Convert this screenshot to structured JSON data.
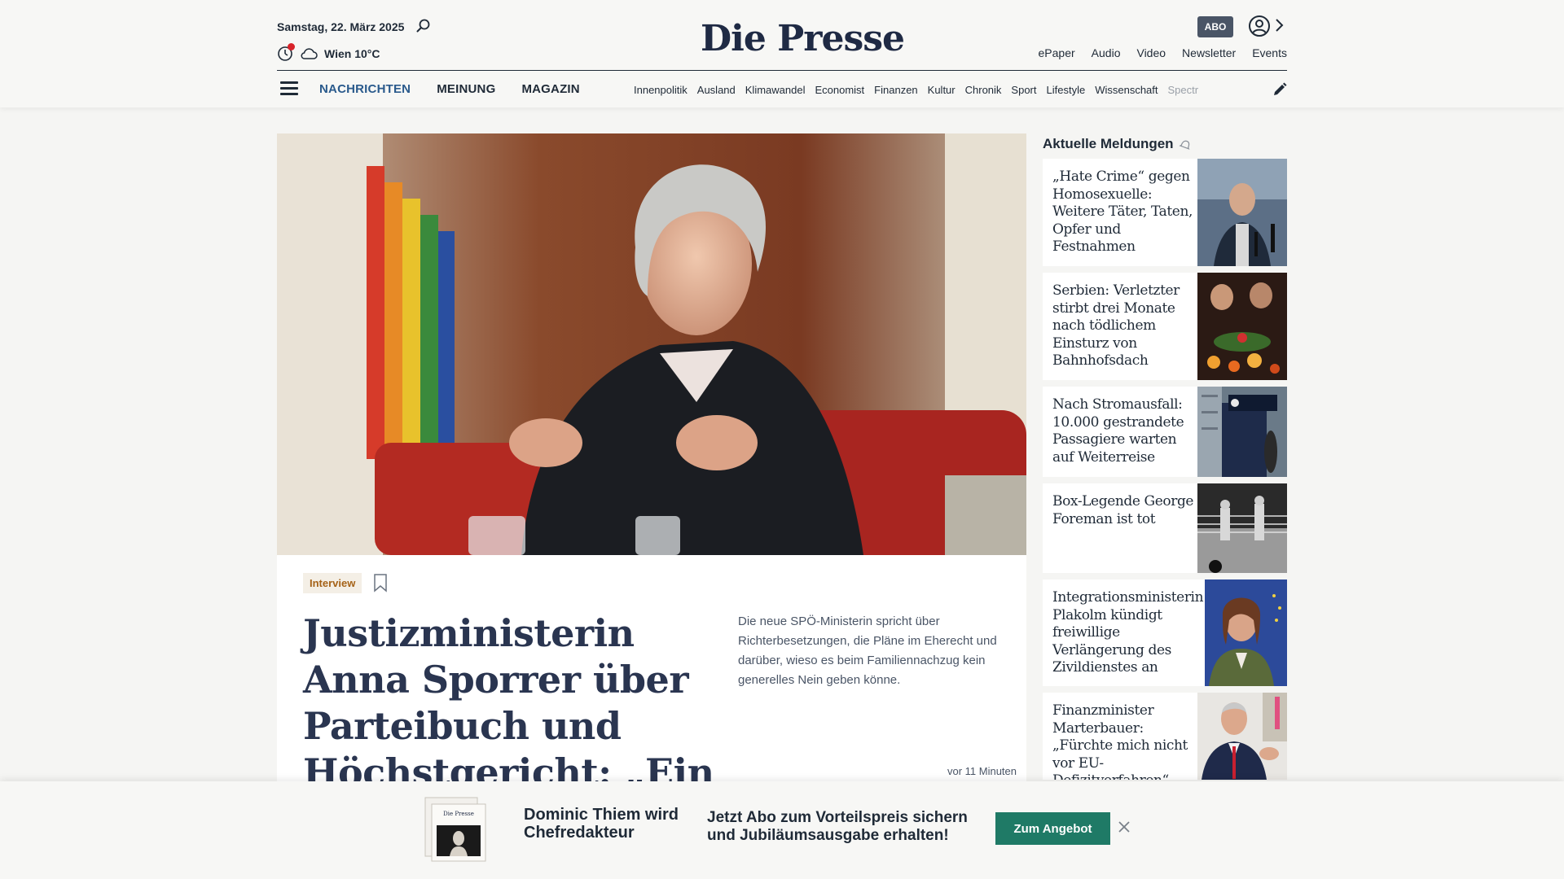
{
  "header": {
    "date": "Samstag, 22. März 2025",
    "weather": "Wien 10°C",
    "logo": "Die Presse",
    "abo_badge": "ABO",
    "top_links": [
      "ePaper",
      "Audio",
      "Video",
      "Newsletter",
      "Events"
    ],
    "main_nav": [
      {
        "label": "NACHRICHTEN",
        "active": true
      },
      {
        "label": "MEINUNG",
        "active": false
      },
      {
        "label": "MAGAZIN",
        "active": false
      }
    ],
    "sub_nav": [
      "Innenpolitik",
      "Ausland",
      "Klimawandel",
      "Economist",
      "Finanzen",
      "Kultur",
      "Chronik",
      "Sport",
      "Lifestyle",
      "Wissenschaft"
    ],
    "sub_nav_truncated": "Spectr"
  },
  "article": {
    "tag": "Interview",
    "headline": "Justizministerin Anna Sporrer über Parteibuch und Höchstgericht: „Ein eingespieltes System“",
    "teaser": "Die neue SPÖ-Ministerin spricht über Richterbesetzungen, die Pläne im Eherecht und darüber, wieso es beim Familiennachzug kein generelles Nein geben könne.",
    "age": "vor 11 Minuten"
  },
  "sidebar": {
    "title": "Aktuelle Meldungen",
    "items": [
      {
        "title": "„Hate Crime“ gegen Homosexuelle: Weitere Täter, Taten, Opfer und Festnahmen"
      },
      {
        "title": "Serbien: Verletzter stirbt drei Monate nach tödlichem Einsturz von Bahnhofsdach"
      },
      {
        "title": "Nach Stromausfall: 10.000 gestrandete Passagiere warten auf Weiterreise"
      },
      {
        "title": "Box-Legende George Foreman ist tot"
      },
      {
        "title": "Integrationsministerin Plakolm kündigt freiwillige Verlängerung des Zivildienstes an"
      },
      {
        "title": "Finanzminister Marterbauer: „Fürchte mich nicht vor EU-Defizitverfahren“"
      }
    ]
  },
  "promo": {
    "title": "Dominic Thiem wird Chefredakteur",
    "text": "Jetzt Abo zum Vorteilspreis sichern und Jubiläumsausgabe erhalten!",
    "button": "Zum Angebot",
    "paper_masthead": "Die Presse"
  },
  "colors": {
    "nav_active": "#2a5a8c",
    "tag_text": "#a56217",
    "button_green": "#1f7a66",
    "headline": "#2a3550"
  }
}
